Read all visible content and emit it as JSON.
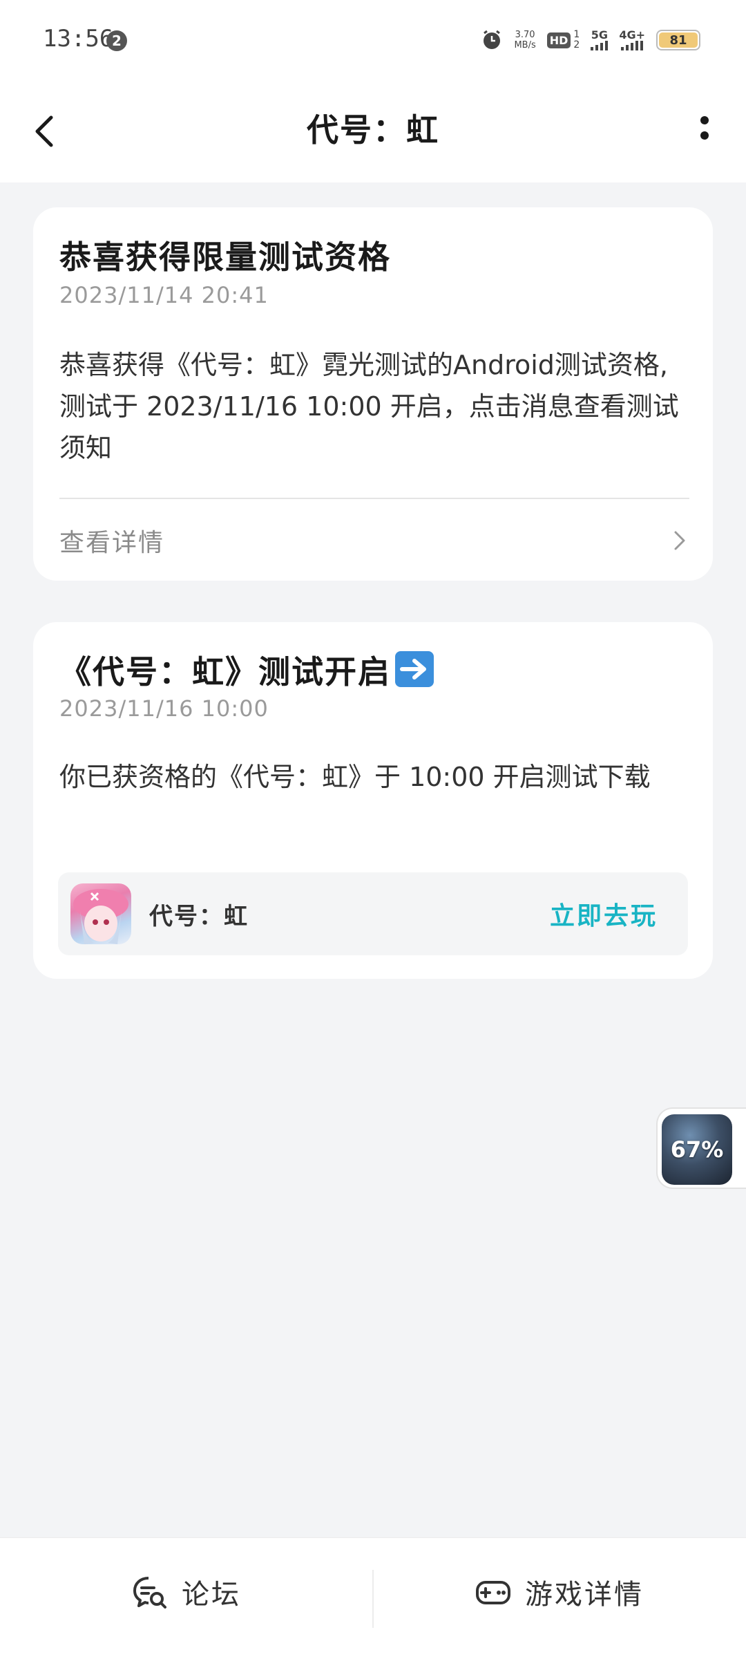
{
  "status_bar": {
    "time": "13:56",
    "notification_count": "2",
    "speed_value": "3.70",
    "speed_unit": "MB/s",
    "hd_label": "HD",
    "hd_sub": "1\n2",
    "net1": "5G",
    "net2": "4G+",
    "battery": "81"
  },
  "header": {
    "title": "代号：虹"
  },
  "messages": [
    {
      "title": "恭喜获得限量测试资格",
      "time": "2023/11/14 20:41",
      "body": "恭喜获得《代号：虹》霓光测试的Android测试资格,测试于 2023/11/16 10:00 开启，点击消息查看测试须知",
      "detail_label": "查看详情"
    },
    {
      "title": "《代号：虹》测试开启",
      "time": "2023/11/16 10:00",
      "body": "你已获资格的《代号：虹》于 10:00 开启测试下载",
      "game_name": "代号：虹",
      "play_label": "立即去玩"
    }
  ],
  "floating": {
    "percent": "67%"
  },
  "bottom_nav": {
    "forum_label": "论坛",
    "game_detail_label": "游戏详情"
  },
  "colors": {
    "accent": "#19b4c4",
    "background": "#f3f4f6"
  }
}
